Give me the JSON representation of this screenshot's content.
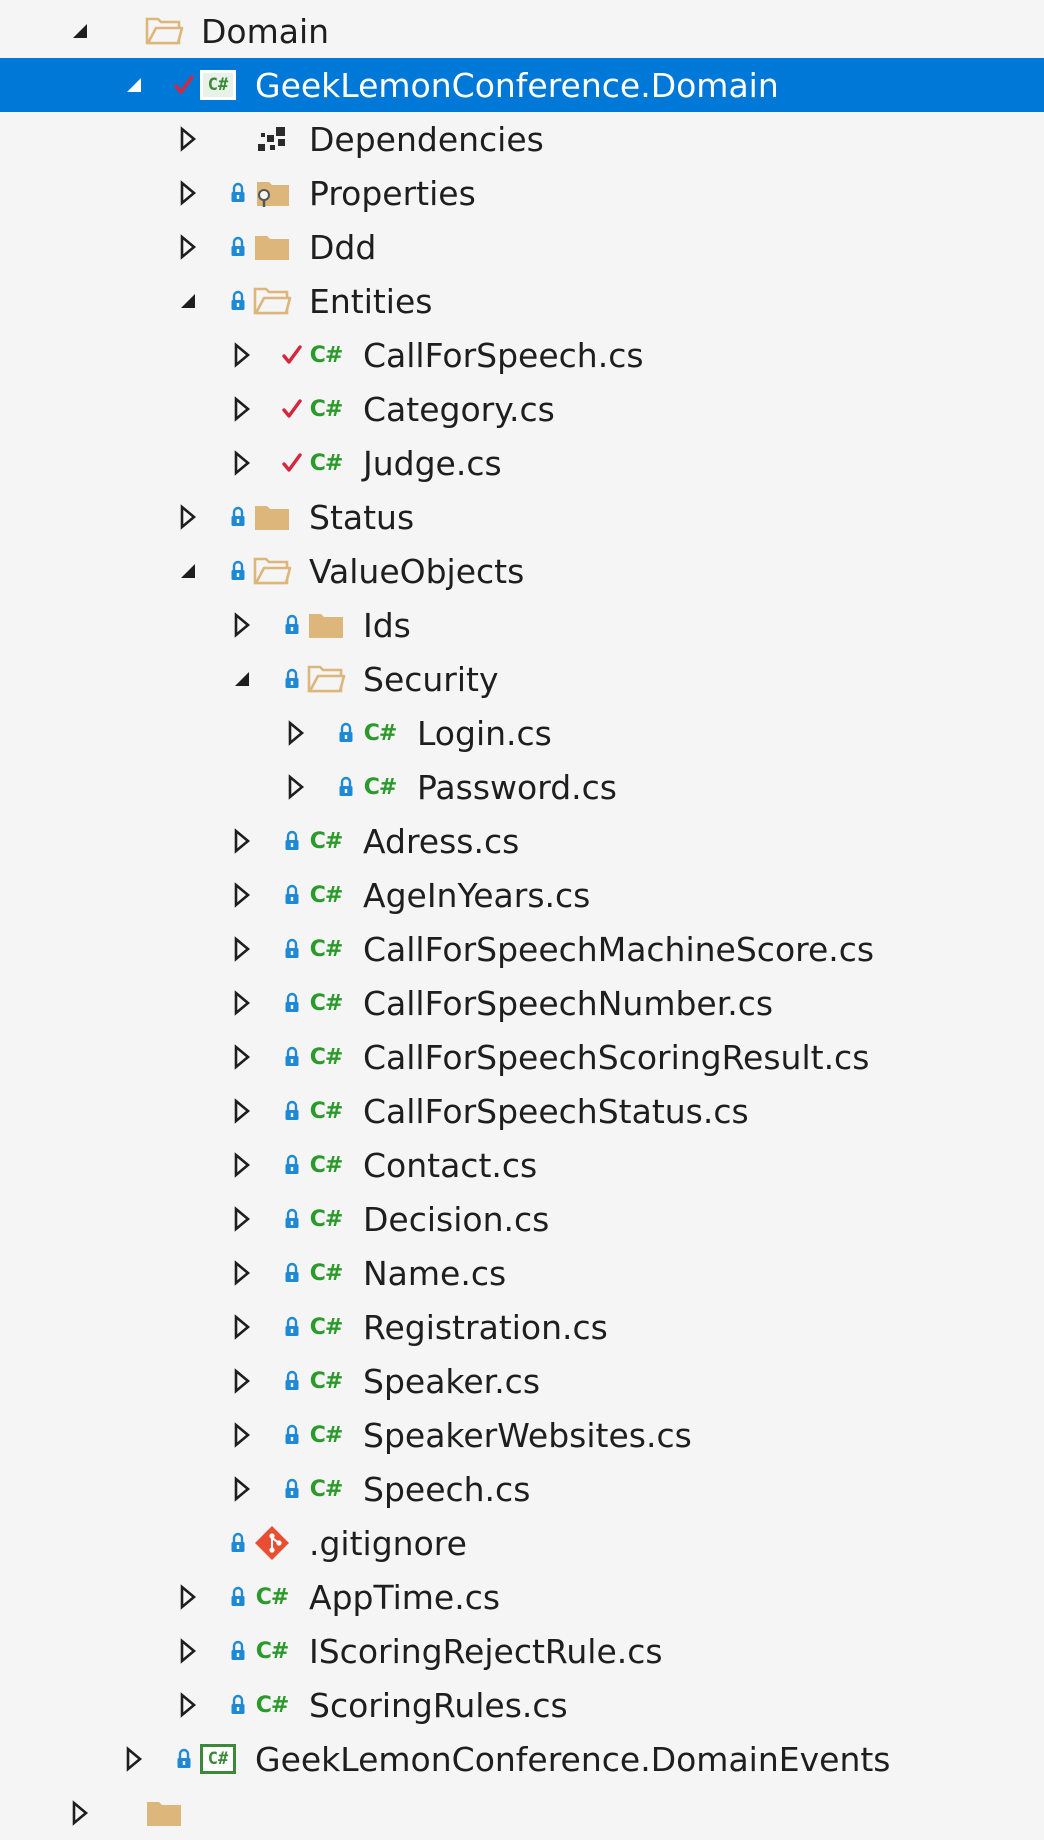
{
  "colors": {
    "selected_bg": "#0078d7",
    "folder": "#dcb67a",
    "csharp": "#2a9a2a",
    "lock": "#1e8ad6",
    "check": "#d7263d",
    "git": "#e84e31"
  },
  "tree": {
    "items": [
      {
        "label": "Domain",
        "depth": 1,
        "expander": "expanded",
        "icon": "folder-open-icon",
        "marker": "none"
      },
      {
        "label": "GeekLemonConference.Domain",
        "depth": 2,
        "expander": "expanded",
        "icon": "csharp-project-icon",
        "marker": "check",
        "selected": true
      },
      {
        "label": "Dependencies",
        "depth": 3,
        "expander": "collapsed",
        "icon": "dependencies-icon",
        "marker": "none"
      },
      {
        "label": "Properties",
        "depth": 3,
        "expander": "collapsed",
        "icon": "properties-folder-icon",
        "marker": "lock"
      },
      {
        "label": "Ddd",
        "depth": 3,
        "expander": "collapsed",
        "icon": "folder-icon",
        "marker": "lock"
      },
      {
        "label": "Entities",
        "depth": 3,
        "expander": "expanded",
        "icon": "folder-open-icon",
        "marker": "lock"
      },
      {
        "label": "CallForSpeech.cs",
        "depth": 4,
        "expander": "collapsed",
        "icon": "csharp-file-icon",
        "marker": "check"
      },
      {
        "label": "Category.cs",
        "depth": 4,
        "expander": "collapsed",
        "icon": "csharp-file-icon",
        "marker": "check"
      },
      {
        "label": "Judge.cs",
        "depth": 4,
        "expander": "collapsed",
        "icon": "csharp-file-icon",
        "marker": "check"
      },
      {
        "label": "Status",
        "depth": 3,
        "expander": "collapsed",
        "icon": "folder-icon",
        "marker": "lock"
      },
      {
        "label": "ValueObjects",
        "depth": 3,
        "expander": "expanded",
        "icon": "folder-open-icon",
        "marker": "lock"
      },
      {
        "label": "Ids",
        "depth": 4,
        "expander": "collapsed",
        "icon": "folder-icon",
        "marker": "lock"
      },
      {
        "label": "Security",
        "depth": 4,
        "expander": "expanded",
        "icon": "folder-open-icon",
        "marker": "lock"
      },
      {
        "label": "Login.cs",
        "depth": 5,
        "expander": "collapsed",
        "icon": "csharp-file-icon",
        "marker": "lock"
      },
      {
        "label": "Password.cs",
        "depth": 5,
        "expander": "collapsed",
        "icon": "csharp-file-icon",
        "marker": "lock"
      },
      {
        "label": "Adress.cs",
        "depth": 4,
        "expander": "collapsed",
        "icon": "csharp-file-icon",
        "marker": "lock"
      },
      {
        "label": "AgeInYears.cs",
        "depth": 4,
        "expander": "collapsed",
        "icon": "csharp-file-icon",
        "marker": "lock"
      },
      {
        "label": "CallForSpeechMachineScore.cs",
        "depth": 4,
        "expander": "collapsed",
        "icon": "csharp-file-icon",
        "marker": "lock"
      },
      {
        "label": "CallForSpeechNumber.cs",
        "depth": 4,
        "expander": "collapsed",
        "icon": "csharp-file-icon",
        "marker": "lock"
      },
      {
        "label": "CallForSpeechScoringResult.cs",
        "depth": 4,
        "expander": "collapsed",
        "icon": "csharp-file-icon",
        "marker": "lock"
      },
      {
        "label": "CallForSpeechStatus.cs",
        "depth": 4,
        "expander": "collapsed",
        "icon": "csharp-file-icon",
        "marker": "lock"
      },
      {
        "label": "Contact.cs",
        "depth": 4,
        "expander": "collapsed",
        "icon": "csharp-file-icon",
        "marker": "lock"
      },
      {
        "label": "Decision.cs",
        "depth": 4,
        "expander": "collapsed",
        "icon": "csharp-file-icon",
        "marker": "lock"
      },
      {
        "label": "Name.cs",
        "depth": 4,
        "expander": "collapsed",
        "icon": "csharp-file-icon",
        "marker": "lock"
      },
      {
        "label": "Registration.cs",
        "depth": 4,
        "expander": "collapsed",
        "icon": "csharp-file-icon",
        "marker": "lock"
      },
      {
        "label": "Speaker.cs",
        "depth": 4,
        "expander": "collapsed",
        "icon": "csharp-file-icon",
        "marker": "lock"
      },
      {
        "label": "SpeakerWebsites.cs",
        "depth": 4,
        "expander": "collapsed",
        "icon": "csharp-file-icon",
        "marker": "lock"
      },
      {
        "label": "Speech.cs",
        "depth": 4,
        "expander": "collapsed",
        "icon": "csharp-file-icon",
        "marker": "lock"
      },
      {
        "label": ".gitignore",
        "depth": 3,
        "expander": "none",
        "icon": "git-icon",
        "marker": "lock"
      },
      {
        "label": "AppTime.cs",
        "depth": 3,
        "expander": "collapsed",
        "icon": "csharp-file-icon",
        "marker": "lock"
      },
      {
        "label": "IScoringRejectRule.cs",
        "depth": 3,
        "expander": "collapsed",
        "icon": "csharp-file-icon",
        "marker": "lock"
      },
      {
        "label": "ScoringRules.cs",
        "depth": 3,
        "expander": "collapsed",
        "icon": "csharp-file-icon",
        "marker": "lock"
      },
      {
        "label": "GeekLemonConference.DomainEvents",
        "depth": 2,
        "expander": "collapsed",
        "icon": "csharp-project-icon",
        "marker": "lock"
      },
      {
        "label": "",
        "depth": 1,
        "expander": "collapsed",
        "icon": "folder-icon",
        "marker": "none"
      }
    ]
  }
}
